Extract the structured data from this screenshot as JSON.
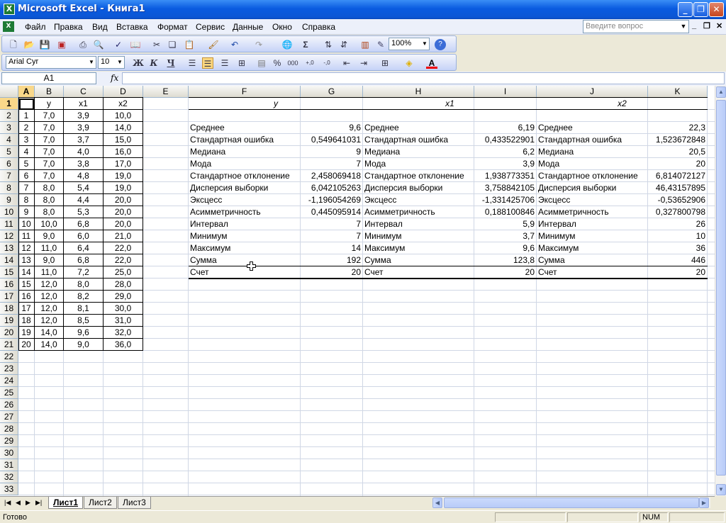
{
  "window": {
    "title": "Microsoft Excel - Книга1",
    "icon": "excel-icon"
  },
  "menu": {
    "items": [
      "Файл",
      "Правка",
      "Вид",
      "Вставка",
      "Формат",
      "Сервис",
      "Данные",
      "Окно",
      "Справка"
    ],
    "help_placeholder": "Введите вопрос"
  },
  "toolbar": {
    "zoom": "100%",
    "font": "Arial Cyr",
    "size": "10",
    "bold": "Ж",
    "italic": "К",
    "underline": "Ч"
  },
  "formula_bar": {
    "cell_ref": "A1",
    "fx": "fx",
    "content": ""
  },
  "columns": [
    "A",
    "B",
    "C",
    "D",
    "E",
    "F",
    "G",
    "H",
    "I",
    "J",
    "K"
  ],
  "rows": [
    "1",
    "2",
    "3",
    "4",
    "5",
    "6",
    "7",
    "8",
    "9",
    "10",
    "11",
    "12",
    "13",
    "14",
    "15",
    "16",
    "17",
    "18",
    "19",
    "20",
    "21",
    "22",
    "23",
    "24",
    "25",
    "26",
    "27",
    "28",
    "29",
    "30",
    "31",
    "32",
    "33"
  ],
  "data_table": {
    "headers": [
      "",
      "y",
      "x1",
      "x2"
    ],
    "rows": [
      [
        "1",
        "7,0",
        "3,9",
        "10,0"
      ],
      [
        "2",
        "7,0",
        "3,9",
        "14,0"
      ],
      [
        "3",
        "7,0",
        "3,7",
        "15,0"
      ],
      [
        "4",
        "7,0",
        "4,0",
        "16,0"
      ],
      [
        "5",
        "7,0",
        "3,8",
        "17,0"
      ],
      [
        "6",
        "7,0",
        "4,8",
        "19,0"
      ],
      [
        "7",
        "8,0",
        "5,4",
        "19,0"
      ],
      [
        "8",
        "8,0",
        "4,4",
        "20,0"
      ],
      [
        "9",
        "8,0",
        "5,3",
        "20,0"
      ],
      [
        "10",
        "10,0",
        "6,8",
        "20,0"
      ],
      [
        "11",
        "9,0",
        "6,0",
        "21,0"
      ],
      [
        "12",
        "11,0",
        "6,4",
        "22,0"
      ],
      [
        "13",
        "9,0",
        "6,8",
        "22,0"
      ],
      [
        "14",
        "11,0",
        "7,2",
        "25,0"
      ],
      [
        "15",
        "12,0",
        "8,0",
        "28,0"
      ],
      [
        "16",
        "12,0",
        "8,2",
        "29,0"
      ],
      [
        "17",
        "12,0",
        "8,1",
        "30,0"
      ],
      [
        "18",
        "12,0",
        "8,5",
        "31,0"
      ],
      [
        "19",
        "14,0",
        "9,6",
        "32,0"
      ],
      [
        "20",
        "14,0",
        "9,0",
        "36,0"
      ]
    ]
  },
  "stats": {
    "labels": [
      "Среднее",
      "Стандартная ошибка",
      "Медиана",
      "Мода",
      "Стандартное отклонение",
      "Дисперсия выборки",
      "Эксцесс",
      "Асимметричность",
      "Интервал",
      "Минимум",
      "Максимум",
      "Сумма",
      "Счет"
    ],
    "blocks": [
      {
        "header": "y",
        "values": [
          "9,6",
          "0,549641031",
          "9",
          "7",
          "2,458069418",
          "6,042105263",
          "-1,196054269",
          "0,445095914",
          "7",
          "7",
          "14",
          "192",
          "20"
        ]
      },
      {
        "header": "x1",
        "values": [
          "6,19",
          "0,433522901",
          "6,2",
          "3,9",
          "1,938773351",
          "3,758842105",
          "-1,331425706",
          "0,188100846",
          "5,9",
          "3,7",
          "9,6",
          "123,8",
          "20"
        ]
      },
      {
        "header": "x2",
        "values": [
          "22,3",
          "1,523672848",
          "20,5",
          "20",
          "6,814072127",
          "46,43157895",
          "-0,53652906",
          "0,327800798",
          "26",
          "10",
          "36",
          "446",
          "20"
        ]
      }
    ]
  },
  "sheets": [
    "Лист1",
    "Лист2",
    "Лист3"
  ],
  "status": {
    "text": "Готово",
    "num": "NUM"
  }
}
